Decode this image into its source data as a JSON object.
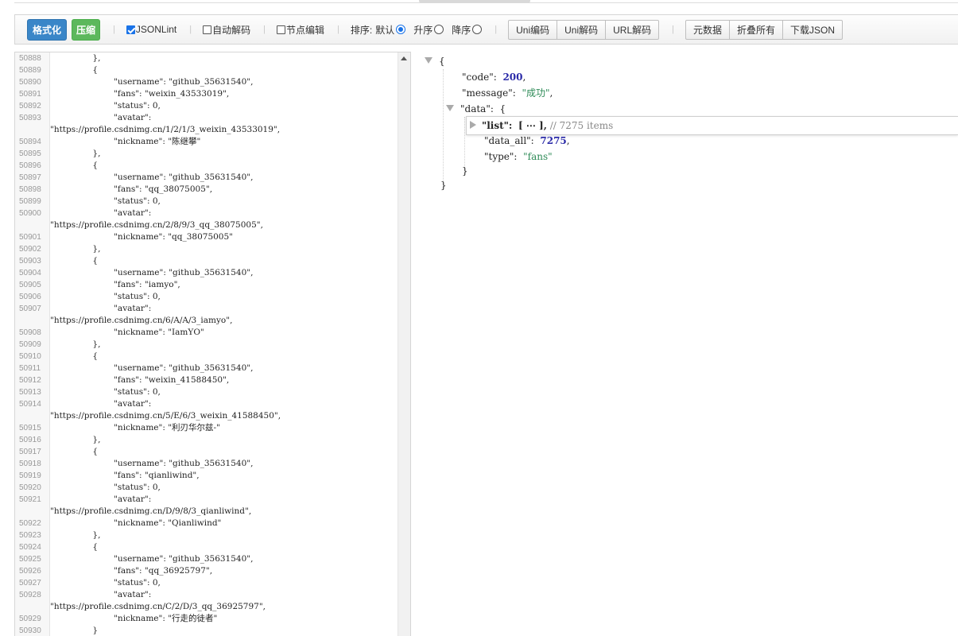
{
  "toolbar": {
    "format_label": "格式化",
    "compress_label": "压缩",
    "jsonlint_label": "JSONLint",
    "auto_decode_label": "自动解码",
    "node_edit_label": "节点编辑",
    "sort_label": "排序:",
    "sort_default_label": "默认",
    "sort_asc_label": "升序",
    "sort_desc_label": "降序",
    "uni_encode_label": "Uni编码",
    "uni_decode_label": "Uni解码",
    "url_decode_label": "URL解码",
    "metadata_label": "元数据",
    "fold_all_label": "折叠所有",
    "download_label": "下载JSON"
  },
  "editor": {
    "lines": [
      {
        "n": "50888",
        "t": "                },"
      },
      {
        "n": "50889",
        "t": "                {"
      },
      {
        "n": "50890",
        "t": "                        \"username\": \"github_35631540\","
      },
      {
        "n": "50891",
        "t": "                        \"fans\": \"weixin_43533019\","
      },
      {
        "n": "50892",
        "t": "                        \"status\": 0,"
      },
      {
        "n": "50893",
        "t": "                        \"avatar\":"
      },
      {
        "n": "",
        "t": "\"https://profile.csdnimg.cn/1/2/1/3_weixin_43533019\","
      },
      {
        "n": "50894",
        "t": "                        \"nickname\": \"陈继攀\""
      },
      {
        "n": "50895",
        "t": "                },"
      },
      {
        "n": "50896",
        "t": "                {"
      },
      {
        "n": "50897",
        "t": "                        \"username\": \"github_35631540\","
      },
      {
        "n": "50898",
        "t": "                        \"fans\": \"qq_38075005\","
      },
      {
        "n": "50899",
        "t": "                        \"status\": 0,"
      },
      {
        "n": "50900",
        "t": "                        \"avatar\":"
      },
      {
        "n": "",
        "t": "\"https://profile.csdnimg.cn/2/8/9/3_qq_38075005\","
      },
      {
        "n": "50901",
        "t": "                        \"nickname\": \"qq_38075005\""
      },
      {
        "n": "50902",
        "t": "                },"
      },
      {
        "n": "50903",
        "t": "                {"
      },
      {
        "n": "50904",
        "t": "                        \"username\": \"github_35631540\","
      },
      {
        "n": "50905",
        "t": "                        \"fans\": \"iamyo\","
      },
      {
        "n": "50906",
        "t": "                        \"status\": 0,"
      },
      {
        "n": "50907",
        "t": "                        \"avatar\":"
      },
      {
        "n": "",
        "t": "\"https://profile.csdnimg.cn/6/A/A/3_iamyo\","
      },
      {
        "n": "50908",
        "t": "                        \"nickname\": \"IamYO\""
      },
      {
        "n": "50909",
        "t": "                },"
      },
      {
        "n": "50910",
        "t": "                {"
      },
      {
        "n": "50911",
        "t": "                        \"username\": \"github_35631540\","
      },
      {
        "n": "50912",
        "t": "                        \"fans\": \"weixin_41588450\","
      },
      {
        "n": "50913",
        "t": "                        \"status\": 0,"
      },
      {
        "n": "50914",
        "t": "                        \"avatar\":"
      },
      {
        "n": "",
        "t": "\"https://profile.csdnimg.cn/5/E/6/3_weixin_41588450\","
      },
      {
        "n": "50915",
        "t": "                        \"nickname\": \"利刃华尔兹-\""
      },
      {
        "n": "50916",
        "t": "                },"
      },
      {
        "n": "50917",
        "t": "                {"
      },
      {
        "n": "50918",
        "t": "                        \"username\": \"github_35631540\","
      },
      {
        "n": "50919",
        "t": "                        \"fans\": \"qianliwind\","
      },
      {
        "n": "50920",
        "t": "                        \"status\": 0,"
      },
      {
        "n": "50921",
        "t": "                        \"avatar\":"
      },
      {
        "n": "",
        "t": "\"https://profile.csdnimg.cn/D/9/8/3_qianliwind\","
      },
      {
        "n": "50922",
        "t": "                        \"nickname\": \"Qianliwind\""
      },
      {
        "n": "50923",
        "t": "                },"
      },
      {
        "n": "50924",
        "t": "                {"
      },
      {
        "n": "50925",
        "t": "                        \"username\": \"github_35631540\","
      },
      {
        "n": "50926",
        "t": "                        \"fans\": \"qq_36925797\","
      },
      {
        "n": "50927",
        "t": "                        \"status\": 0,"
      },
      {
        "n": "50928",
        "t": "                        \"avatar\":"
      },
      {
        "n": "",
        "t": "\"https://profile.csdnimg.cn/C/2/D/3_qq_36925797\","
      },
      {
        "n": "50929",
        "t": "                        \"nickname\": \"行走的徒者\""
      },
      {
        "n": "50930",
        "t": "                }"
      }
    ]
  },
  "tree": {
    "open_brace": "{",
    "close_brace": "}",
    "code_key": "\"code\":",
    "code_val": "200",
    "message_key": "\"message\":",
    "message_val": "\"成功\"",
    "data_key": "\"data\":",
    "data_open": "{",
    "list_key": "\"list\":",
    "list_val": "[ ⋯ ],",
    "list_comment": "// 7275 items",
    "data_all_key": "\"data_all\":",
    "data_all_val": "7275",
    "type_key": "\"type\":",
    "type_val": "\"fans\"",
    "data_close": "}",
    "comma": ","
  }
}
